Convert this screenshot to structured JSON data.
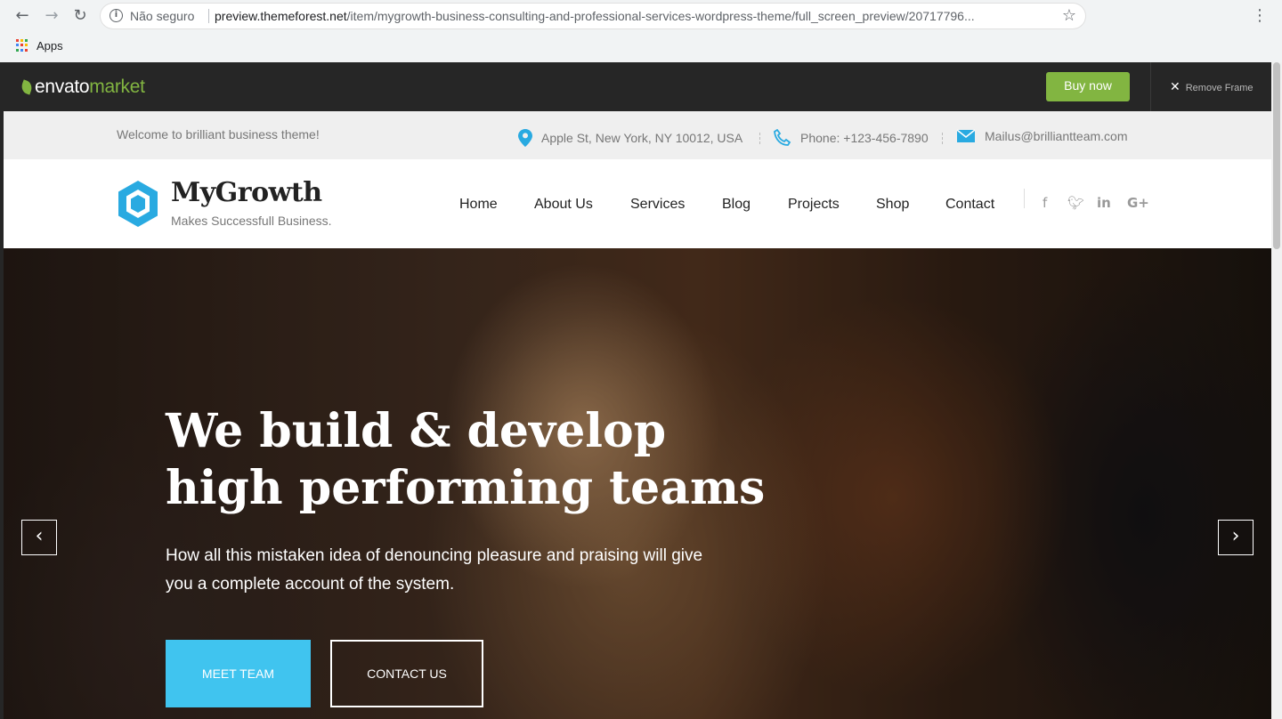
{
  "browser": {
    "security_label": "Não seguro",
    "url_host": "preview.themeforest.net",
    "url_path": "/item/mygrowth-business-consulting-and-professional-services-wordpress-theme/full_screen_preview/20717796...",
    "bookmark_apps": "Apps"
  },
  "envato": {
    "logo_word": "envato",
    "logo_market": "market",
    "buy_now": "Buy now",
    "remove_frame": "Remove Frame",
    "accent": "#82b541"
  },
  "topbar": {
    "welcome": "Welcome to brilliant business theme!",
    "address": "Apple St, New York, NY 10012, USA",
    "phone": "Phone: +123-456-7890",
    "email": "Mailus@brilliantteam.com"
  },
  "header": {
    "brand": "MyGrowth",
    "tagline": "Makes Successfull Business.",
    "nav": [
      "Home",
      "About Us",
      "Services",
      "Blog",
      "Projects",
      "Shop",
      "Contact"
    ],
    "social": [
      "facebook-icon",
      "twitter-icon",
      "linkedin-icon",
      "google-plus-icon"
    ],
    "brand_color": "#29aae1"
  },
  "hero": {
    "title_line1": "We build & develop",
    "title_line2": "high performing teams",
    "subtitle": "How all this mistaken idea of denouncing pleasure and praising will give you a complete account of the system.",
    "primary_button": "MEET TEAM",
    "secondary_button": "CONTACT US",
    "primary_color": "#40c4ef"
  }
}
